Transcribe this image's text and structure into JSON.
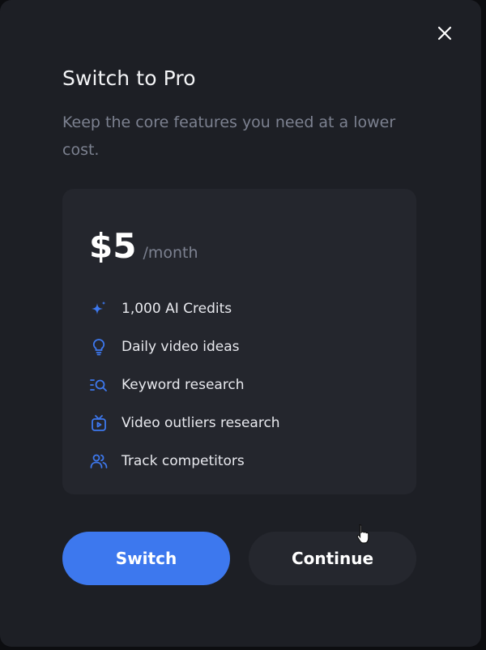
{
  "modal": {
    "title": "Switch to Pro",
    "subtitle": "Keep the core features you need at a lower cost.",
    "close_icon": "close-icon"
  },
  "plan": {
    "price": "$5",
    "period": "/month",
    "features": [
      {
        "label": "1,000 AI Credits",
        "icon": "sparkle-icon"
      },
      {
        "label": "Daily video ideas",
        "icon": "lightbulb-icon"
      },
      {
        "label": "Keyword research",
        "icon": "search-list-icon"
      },
      {
        "label": "Video outliers research",
        "icon": "video-icon"
      },
      {
        "label": "Track competitors",
        "icon": "users-icon"
      }
    ]
  },
  "actions": {
    "switch_label": "Switch",
    "continue_label": "Continue"
  },
  "colors": {
    "accent": "#3d78ee",
    "modal_bg": "#1d1f25",
    "card_bg": "#24262d"
  }
}
